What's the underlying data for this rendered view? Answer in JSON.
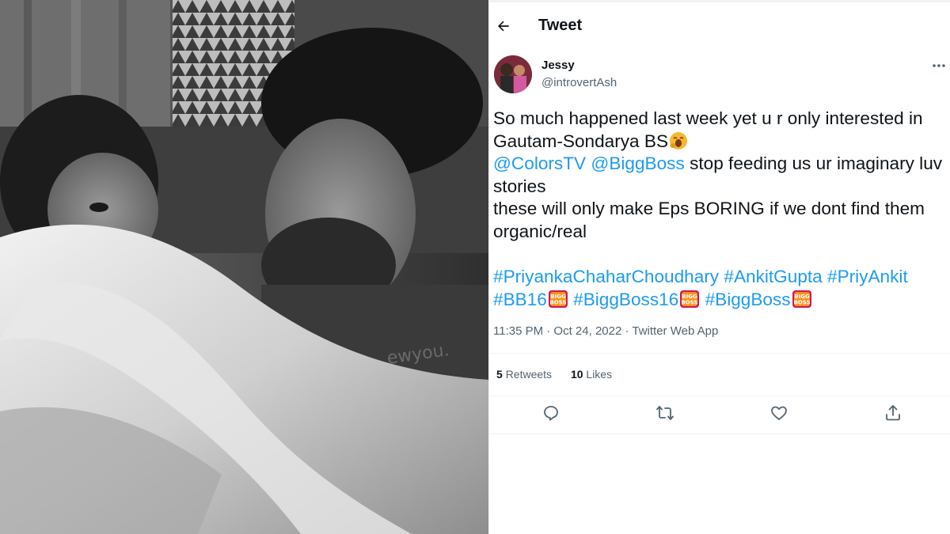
{
  "header": {
    "title": "Tweet"
  },
  "author": {
    "name": "Jessy",
    "handle": "@introvertAsh"
  },
  "tweet": {
    "lines": [
      "So much happened last week yet u r only interested in",
      "Gautam-Sondarya BS",
      "",
      "stop feeding us ur imaginary luv",
      "stories",
      "these will only make Eps BORING if we dont find them",
      "organic/real"
    ],
    "mentions": [
      "@ColorsTV",
      "@BiggBoss"
    ],
    "hashtags_line1": [
      "#PriyankaChaharChoudhary",
      "#AnkitGupta",
      "#PriyAnkit"
    ],
    "hashtags_line2": [
      "#BB16",
      "#BiggBoss16",
      "#BiggBoss"
    ],
    "bb_logo_text": [
      "BIGG",
      "BOSS"
    ]
  },
  "meta": {
    "time": "11:35 PM · Oct 24, 2022 · Twitter Web App"
  },
  "stats": {
    "retweets_count": "5",
    "retweets_label": "Retweets",
    "likes_count": "10",
    "likes_label": "Likes"
  },
  "icons": {
    "back": "arrow-left-icon",
    "more": "more-icon",
    "reply": "reply-icon",
    "retweet": "retweet-icon",
    "like": "like-icon",
    "share": "share-icon"
  },
  "colors": {
    "link": "#1d9bf0",
    "secondary_text": "#536471",
    "divider": "#eff3f4"
  }
}
